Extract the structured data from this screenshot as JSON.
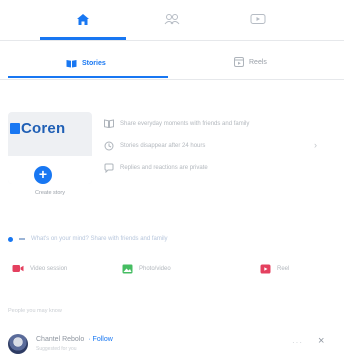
{
  "colors": {
    "accent": "#1877f2",
    "muted": "#b3b8be"
  },
  "nav": {
    "tabs": [
      {
        "icon": "home-icon",
        "active": true
      },
      {
        "icon": "friends-icon",
        "active": false
      },
      {
        "icon": "watch-icon",
        "active": false
      }
    ]
  },
  "subtabs": {
    "stories_label": "Stories",
    "reels_label": "Reels"
  },
  "story": {
    "brand": "Coren",
    "create_label": "Create story"
  },
  "tips": [
    {
      "icon": "book-icon",
      "text": "Share everyday moments with friends and family"
    },
    {
      "icon": "clock-icon",
      "text": "Stories disappear after 24 hours"
    },
    {
      "icon": "chat-icon",
      "text": "Replies and reactions are private"
    }
  ],
  "prompt": {
    "text": "What's on your mind? Share with friends and family"
  },
  "actions": [
    {
      "icon": "video-icon",
      "label": "Video session",
      "color": "#e4405f"
    },
    {
      "icon": "photo-icon",
      "label": "Photo/video",
      "color": "#45bd62"
    },
    {
      "icon": "reel-icon",
      "label": "Reel",
      "color": "#e4405f"
    }
  ],
  "section": {
    "label": "People you may know"
  },
  "person": {
    "name": "Chantel Rebolo",
    "action": "· Follow",
    "subtitle": "Suggested for you",
    "dots": "···",
    "close": "×"
  }
}
